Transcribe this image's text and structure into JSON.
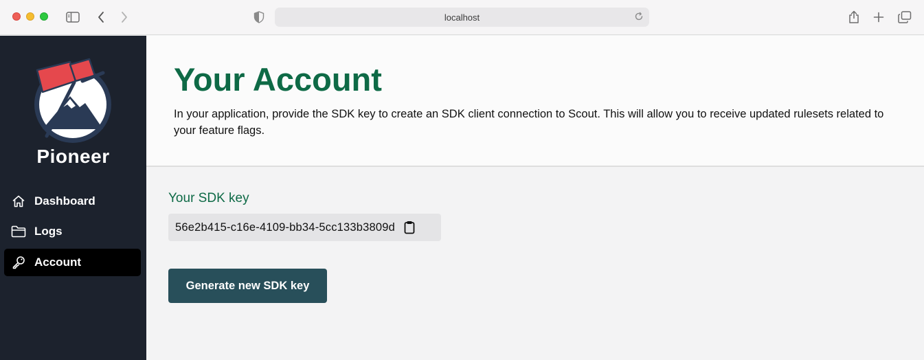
{
  "browser": {
    "url": "localhost",
    "colors": {
      "close": "#ee5f57",
      "minimize": "#f5bd2f",
      "zoom": "#2dc93f"
    },
    "icons": [
      "sidebar-toggle-icon",
      "back-icon",
      "forward-icon",
      "shield-icon",
      "reload-icon",
      "share-icon",
      "new-tab-icon",
      "tab-overview-icon"
    ]
  },
  "sidebar": {
    "brand": "Pioneer",
    "items": [
      {
        "label": "Dashboard",
        "icon": "home-icon",
        "active": false
      },
      {
        "label": "Logs",
        "icon": "folder-icon",
        "active": false
      },
      {
        "label": "Account",
        "icon": "key-icon",
        "active": true
      }
    ]
  },
  "main": {
    "title": "Your Account",
    "description": "In your application, provide the SDK key to create an SDK client connection to Scout. This will allow you to receive updated rulesets related to your feature flags.",
    "sdk_label": "Your SDK key",
    "sdk_key": "56e2b415-c16e-4109-bb34-5cc133b3809d",
    "copy_icon": "clipboard-icon",
    "generate_button": "Generate new SDK key"
  },
  "colors": {
    "accent_green": "#0e6a46",
    "sidebar_bg": "#1c222d",
    "button_bg": "#284f5a",
    "logo_red": "#e5484d",
    "logo_navy": "#2a3a55"
  }
}
